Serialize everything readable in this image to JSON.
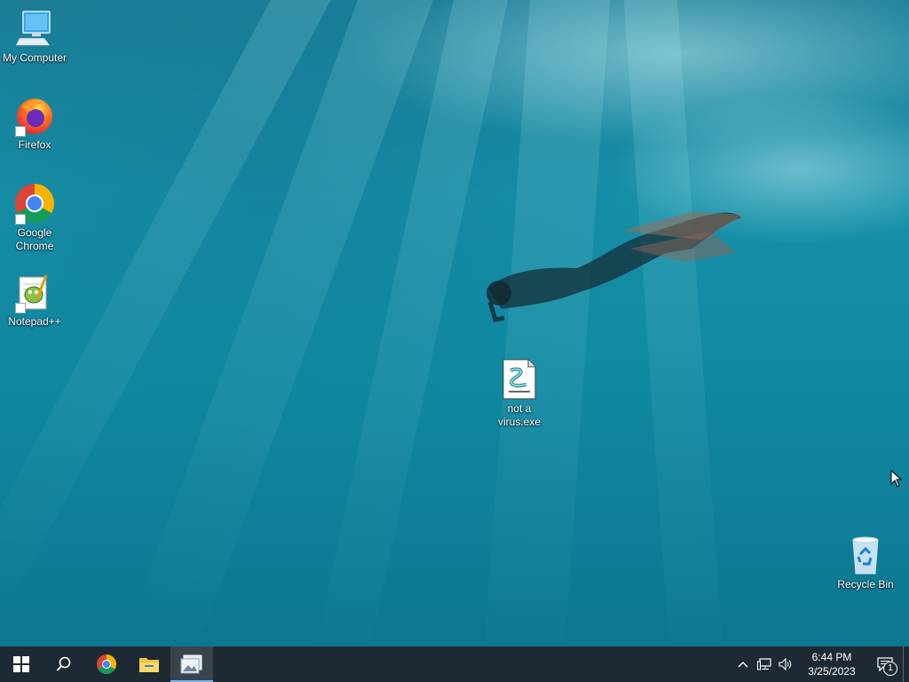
{
  "desktop": {
    "icons": [
      {
        "label": "My Computer",
        "icon": "computer-icon"
      },
      {
        "label": "Firefox",
        "icon": "firefox-icon"
      },
      {
        "label": "Google Chrome",
        "icon": "chrome-icon"
      },
      {
        "label": "Notepad++",
        "icon": "notepadpp-icon"
      },
      {
        "label": "not a virus.exe",
        "icon": "script-file-icon"
      },
      {
        "label": "Recycle Bin",
        "icon": "recycle-bin-icon"
      }
    ]
  },
  "taskbar": {
    "pinned": [
      {
        "name": "start-button",
        "icon": "windows-logo-icon"
      },
      {
        "name": "search-button",
        "icon": "search-icon"
      },
      {
        "name": "chrome-taskbar-button",
        "icon": "chrome-icon"
      },
      {
        "name": "file-explorer-taskbar-button",
        "icon": "folder-icon"
      },
      {
        "name": "active-app-taskbar-button",
        "icon": "image-viewer-icon"
      }
    ],
    "tray": {
      "icons": [
        "chevron-up-icon",
        "network-icon",
        "volume-icon"
      ],
      "time": "6:44 PM",
      "date": "3/25/2023",
      "notification_count": "1"
    }
  },
  "colors": {
    "taskbar_bg": "#1e2a33",
    "accent": "#76b9ed",
    "water": "#118aa2"
  }
}
